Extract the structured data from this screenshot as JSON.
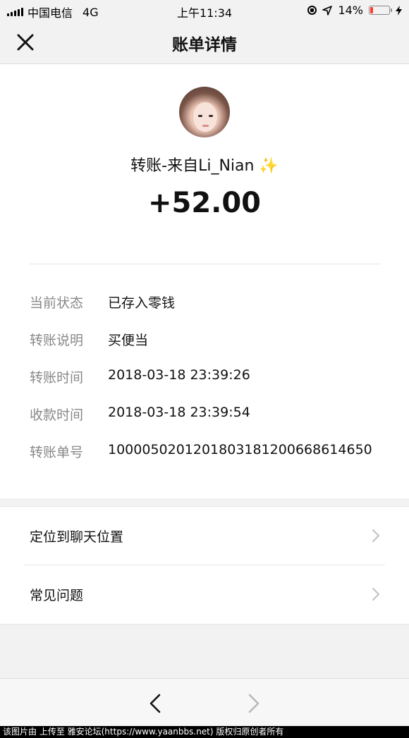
{
  "status_bar": {
    "carrier": "中国电信",
    "network": "4G",
    "time": "上午11:34",
    "battery_percent": "14%",
    "battery_level": 0.14,
    "battery_color": "#ff3b30"
  },
  "header": {
    "title": "账单详情",
    "close_icon": "close-icon"
  },
  "transfer": {
    "payer": "转账-来自Li_Nian ✨",
    "amount": "+52.00"
  },
  "details": [
    {
      "label": "当前状态",
      "value": "已存入零钱"
    },
    {
      "label": "转账说明",
      "value": "买便当"
    },
    {
      "label": "转账时间",
      "value": "2018-03-18 23:39:26"
    },
    {
      "label": "收款时间",
      "value": "2018-03-18 23:39:54"
    },
    {
      "label": "转账单号",
      "value": "100005020120180318120066861465​0"
    }
  ],
  "menu": [
    {
      "label": "定位到聊天位置",
      "icon": "chevron-right-icon"
    },
    {
      "label": "常见问题",
      "icon": "chevron-right-icon"
    }
  ],
  "toolbar": {
    "back_icon": "chevron-left-icon",
    "forward_icon": "chevron-right-icon"
  },
  "watermark": "该图片由 上传至 雅安论坛(https://www.yaanbbs.net) 版权归原创者所有"
}
